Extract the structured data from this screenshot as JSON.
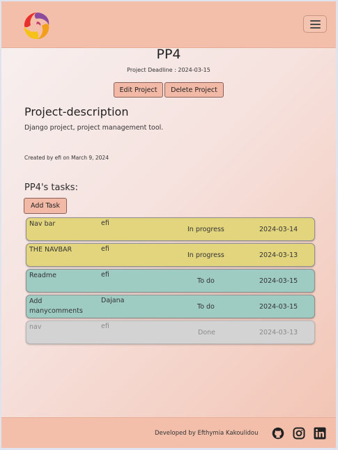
{
  "navbar": {
    "logo_icon": "spiral-logo-icon",
    "toggle_icon": "hamburger-menu-icon"
  },
  "project": {
    "title": "PP4",
    "deadline": "Project Deadline : 2024-03-15",
    "edit_label": "Edit Project",
    "delete_label": "Delete Project",
    "description_heading": "Project-description",
    "description": "Django project, project management tool.",
    "created": "Created by efi on March 9, 2024"
  },
  "tasks": {
    "heading": "PP4's tasks:",
    "add_label": "Add Task",
    "items": [
      {
        "title": "Nav bar",
        "user": "efi",
        "status": "In progress",
        "date": "2024-03-14",
        "color": "#e3d57e"
      },
      {
        "title": "THE NAVBAR",
        "user": "efi",
        "status": "In progress",
        "date": "2024-03-13",
        "color": "#e3d57e"
      },
      {
        "title": "Readme",
        "user": "efi",
        "status": "To do",
        "date": "2024-03-15",
        "color": "#9ecbc2"
      },
      {
        "title": "Add manycomments",
        "user": "Dajana",
        "status": "To do",
        "date": "2024-03-15",
        "color": "#9ecbc2"
      },
      {
        "title": "nav",
        "user": "efi",
        "status": "Done",
        "date": "2024-03-13",
        "color": "#d3d3d3"
      }
    ]
  },
  "footer": {
    "developer": "Developed by Efthymia Kakoulidou",
    "icons": [
      "github-icon",
      "instagram-icon",
      "linkedin-icon"
    ]
  }
}
